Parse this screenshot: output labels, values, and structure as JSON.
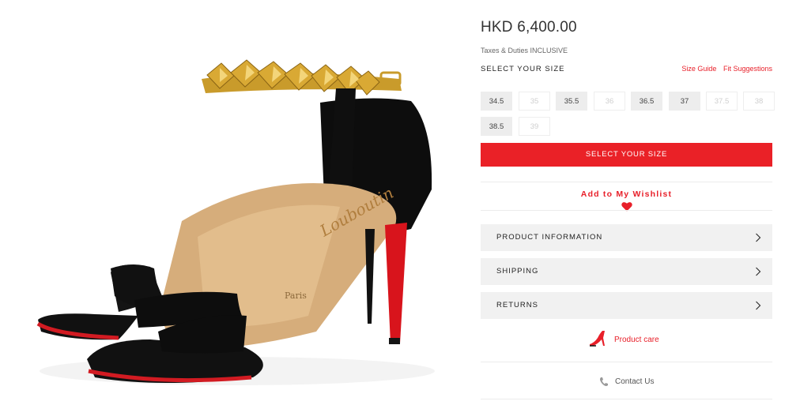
{
  "product": {
    "price": "HKD 6,400.00",
    "tax_note": "Taxes & Duties INCLUSIVE"
  },
  "size_selector": {
    "title": "SELECT YOUR SIZE",
    "size_guide_link": "Size Guide",
    "fit_suggestions_link": "Fit Suggestions",
    "sizes": [
      {
        "label": "34.5",
        "available": true
      },
      {
        "label": "35",
        "available": false
      },
      {
        "label": "35.5",
        "available": true
      },
      {
        "label": "36",
        "available": false
      },
      {
        "label": "36.5",
        "available": true
      },
      {
        "label": "37",
        "available": true
      },
      {
        "label": "37.5",
        "available": false
      },
      {
        "label": "38",
        "available": false
      },
      {
        "label": "38.5",
        "available": true
      },
      {
        "label": "39",
        "available": false
      }
    ],
    "cta_label": "SELECT YOUR SIZE"
  },
  "wishlist": {
    "label": "Add to My Wishlist",
    "icon": "heart-icon"
  },
  "accordions": [
    {
      "label": "PRODUCT INFORMATION",
      "icon": "chevron-right-icon"
    },
    {
      "label": "SHIPPING",
      "icon": "chevron-right-icon"
    },
    {
      "label": "RETURNS",
      "icon": "chevron-right-icon"
    }
  ],
  "product_care": {
    "label": "Product care",
    "icon": "high-heel-icon"
  },
  "contact": {
    "label": "Contact Us",
    "icon": "phone-icon"
  },
  "product_image": {
    "insole_brand": "Paris"
  },
  "colors": {
    "accent": "#e8202a",
    "button_red": "#ea2127",
    "available_size_bg": "#ededed",
    "accordion_bg": "#f1f1f1"
  }
}
